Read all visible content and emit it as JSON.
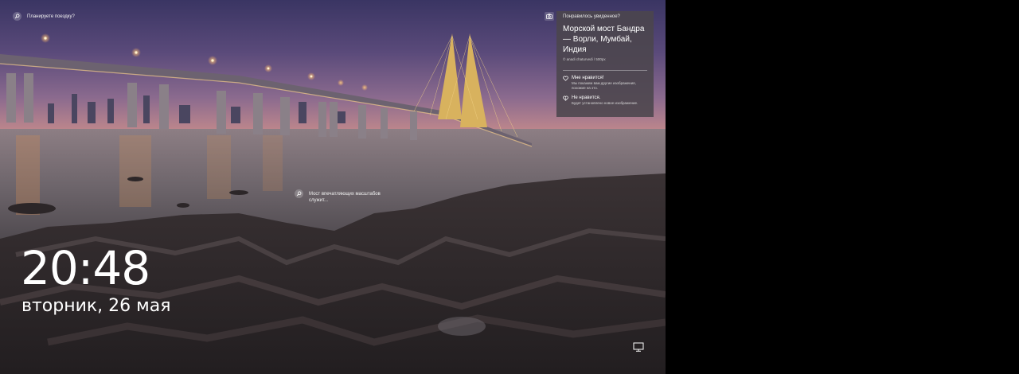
{
  "lockscreen": {
    "plan_trip_hint": "Планируете поездку?",
    "bridge_hint": "Мост впечатляющих масштабов служит...",
    "clock": "20:48",
    "date": "вторник, 26 мая"
  },
  "spotlight_card": {
    "question": "Понравилось увиденное?",
    "title": "Морской мост Бандра — Ворли, Мумбай, Индия",
    "credit": "© anadi chaturvedi / 500px",
    "like_label": "Мне нравится!",
    "like_desc": "Мы покажем вам другие изображения, похожие на это.",
    "dislike_label": "Не нравится.",
    "dislike_desc": "Будет установлено новое изображение."
  },
  "icons": {
    "search": "search-icon",
    "camera": "camera-icon",
    "like": "heart-icon",
    "dislike": "broken-heart-icon",
    "network": "network-icon"
  }
}
